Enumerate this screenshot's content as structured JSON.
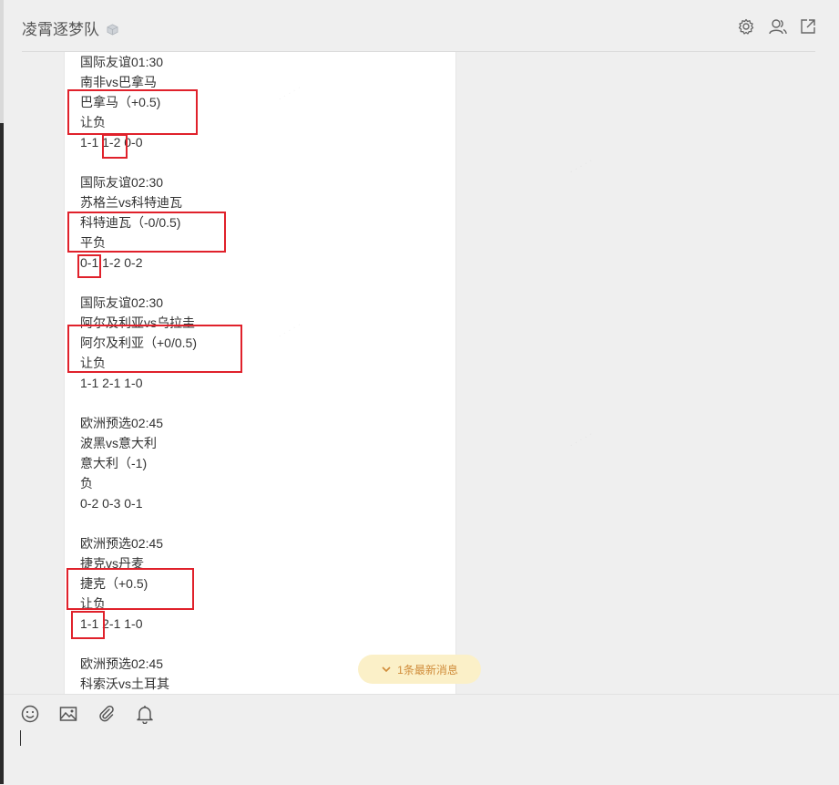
{
  "window": {
    "title": "凌霄逐梦队"
  },
  "header_icons": [
    "gear-icon",
    "members-icon",
    "open-external-icon"
  ],
  "message": {
    "lines": [
      "国际友谊01:30",
      "南非vs巴拿马",
      "巴拿马（+0.5)",
      "让负",
      "1-1 1-2 0-0",
      "",
      "国际友谊02:30",
      "苏格兰vs科特迪瓦",
      "科特迪瓦（-0/0.5)",
      "平负",
      "0-1 1-2 0-2",
      "",
      "国际友谊02:30",
      "阿尔及利亚vs乌拉圭",
      "阿尔及利亚（+0/0.5)",
      "让负",
      "1-1 2-1 1-0",
      "",
      "欧洲预选02:45",
      "波黑vs意大利",
      "意大利（-1)",
      "负",
      "0-2 0-3 0-1",
      "",
      "欧洲预选02:45",
      "捷克vs丹麦",
      "捷克（+0.5)",
      "让负",
      "1-1 2-1 1-0",
      "",
      "欧洲预选02:45",
      "科索沃vs土耳其"
    ]
  },
  "new_message_pill": {
    "label": "1条最新消息"
  },
  "input_toolbar": [
    "emoji-icon",
    "image-icon",
    "attachment-icon",
    "bell-icon"
  ]
}
